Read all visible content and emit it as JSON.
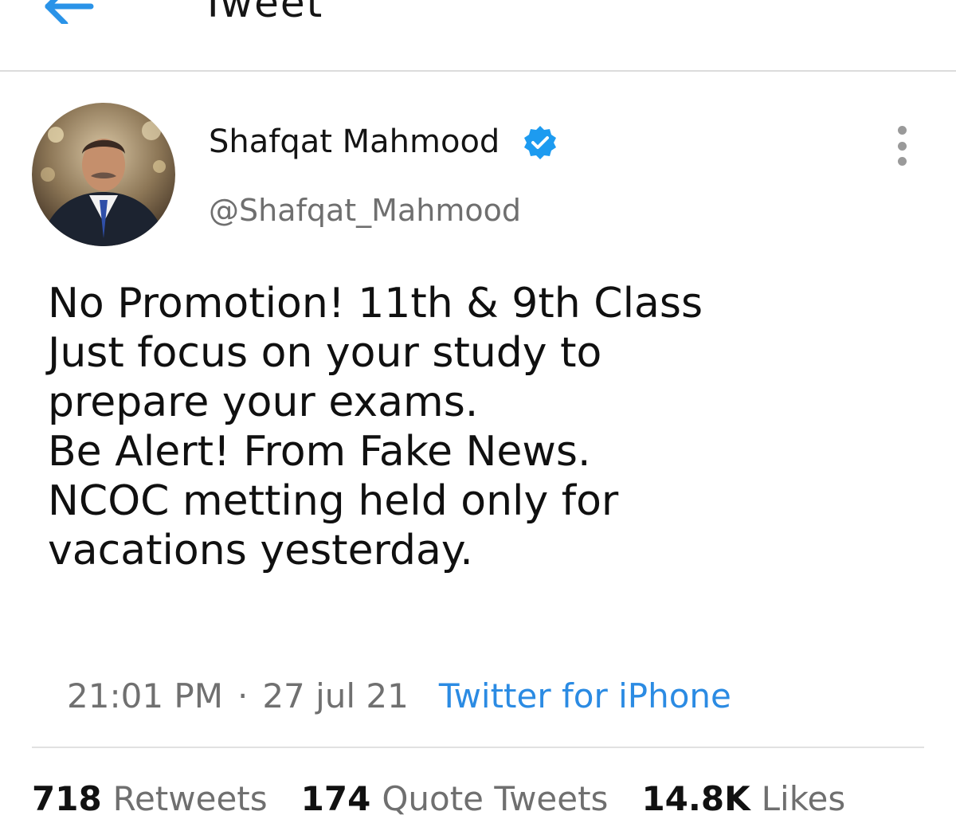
{
  "header": {
    "title": "Tweet",
    "back_icon": "back-arrow-icon"
  },
  "author": {
    "display_name": "Shafqat Mahmood",
    "handle": "@Shafqat_Mahmood",
    "verified_icon": "verified-badge-icon",
    "avatar": "profile-photo"
  },
  "tweet": {
    "lines": [
      "No Promotion! 11th & 9th Class",
      "Just focus on your study to",
      "prepare your exams.",
      "Be Alert! From Fake News.",
      "NCOC metting held only for",
      "vacations yesterday."
    ]
  },
  "meta": {
    "time": "21:01 PM",
    "separator": "·",
    "date": "27 jul 21",
    "source": "Twitter for iPhone"
  },
  "stats": {
    "retweets_count": "718",
    "retweets_label": "Retweets",
    "quotes_count": "174",
    "quotes_label": "Quote Tweets",
    "likes_count": "14.8K",
    "likes_label": "Likes"
  },
  "colors": {
    "accent": "#1d9bf0",
    "link": "#2b8be3",
    "muted": "#707070",
    "divider": "#dcdcdc"
  }
}
